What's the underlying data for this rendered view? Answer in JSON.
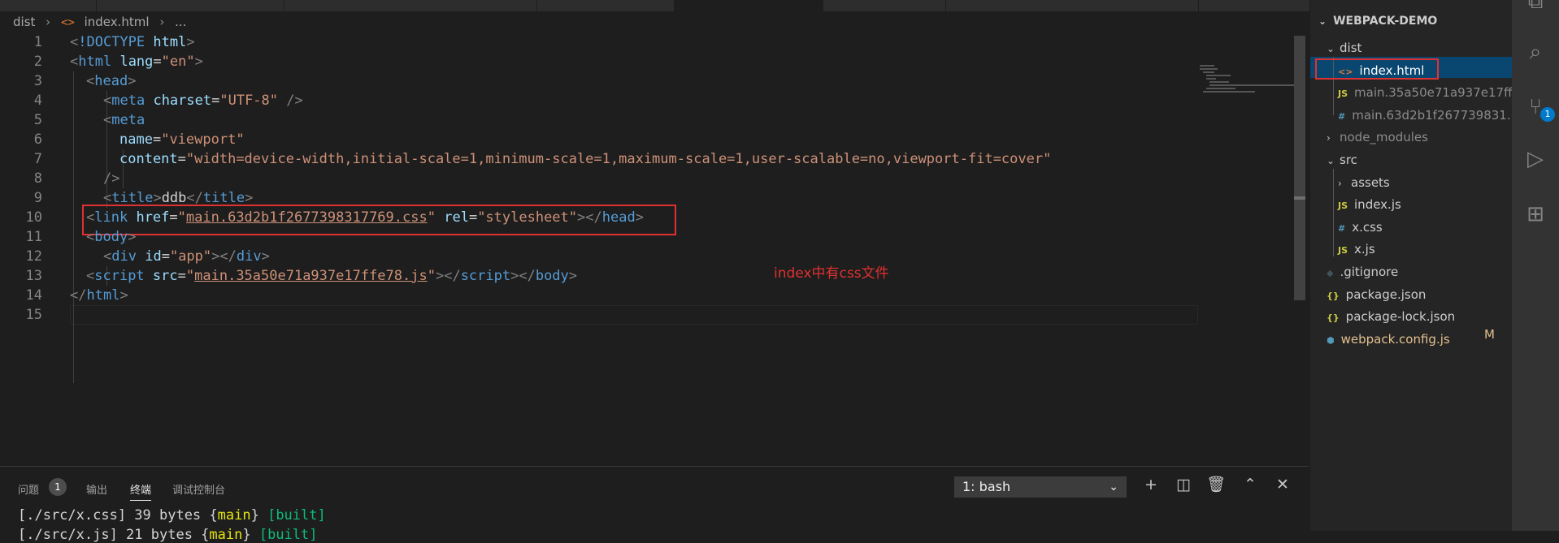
{
  "breadcrumb": {
    "folder": "dist",
    "file": "index.html",
    "more": "..."
  },
  "editor": {
    "lines": [
      {
        "n": "1",
        "indent": 0,
        "tokens": [
          [
            "punc",
            "<"
          ],
          [
            "tag",
            "!DOCTYPE"
          ],
          [
            "text",
            " "
          ],
          [
            "attr",
            "html"
          ],
          [
            "punc",
            ">"
          ]
        ]
      },
      {
        "n": "2",
        "indent": 0,
        "tokens": [
          [
            "punc",
            "<"
          ],
          [
            "tag",
            "html"
          ],
          [
            "text",
            " "
          ],
          [
            "attr",
            "lang"
          ],
          [
            "text",
            "="
          ],
          [
            "str",
            "\"en\""
          ],
          [
            "punc",
            ">"
          ]
        ]
      },
      {
        "n": "3",
        "indent": 1,
        "tokens": [
          [
            "punc",
            "<"
          ],
          [
            "tag",
            "head"
          ],
          [
            "punc",
            ">"
          ]
        ]
      },
      {
        "n": "4",
        "indent": 2,
        "tokens": [
          [
            "punc",
            "<"
          ],
          [
            "tag",
            "meta"
          ],
          [
            "text",
            " "
          ],
          [
            "attr",
            "charset"
          ],
          [
            "text",
            "="
          ],
          [
            "str",
            "\"UTF-8\""
          ],
          [
            "text",
            " "
          ],
          [
            "punc",
            "/>"
          ]
        ]
      },
      {
        "n": "5",
        "indent": 2,
        "tokens": [
          [
            "punc",
            "<"
          ],
          [
            "tag",
            "meta"
          ]
        ]
      },
      {
        "n": "6",
        "indent": 3,
        "tokens": [
          [
            "attr",
            "name"
          ],
          [
            "text",
            "="
          ],
          [
            "str",
            "\"viewport\""
          ]
        ]
      },
      {
        "n": "7",
        "indent": 3,
        "tokens": [
          [
            "attr",
            "content"
          ],
          [
            "text",
            "="
          ],
          [
            "str",
            "\"width=device-width,initial-scale=1,minimum-scale=1,maximum-scale=1,user-scalable=no,viewport-fit=cover\""
          ]
        ]
      },
      {
        "n": "8",
        "indent": 2,
        "tokens": [
          [
            "punc",
            "/>"
          ]
        ]
      },
      {
        "n": "9",
        "indent": 2,
        "tokens": [
          [
            "punc",
            "<"
          ],
          [
            "tag",
            "title"
          ],
          [
            "punc",
            ">"
          ],
          [
            "text",
            "ddb"
          ],
          [
            "punc",
            "</"
          ],
          [
            "tag",
            "title"
          ],
          [
            "punc",
            ">"
          ]
        ]
      },
      {
        "n": "10",
        "indent": 1,
        "tokens": [
          [
            "punc",
            "<"
          ],
          [
            "tag",
            "link"
          ],
          [
            "text",
            " "
          ],
          [
            "attr",
            "href"
          ],
          [
            "text",
            "="
          ],
          [
            "str",
            "\""
          ],
          [
            "strlink",
            "main.63d2b1f2677398317769.css"
          ],
          [
            "str",
            "\""
          ],
          [
            "text",
            " "
          ],
          [
            "attr",
            "rel"
          ],
          [
            "text",
            "="
          ],
          [
            "str",
            "\"stylesheet\""
          ],
          [
            "punc",
            "></"
          ],
          [
            "tag",
            "head"
          ],
          [
            "punc",
            ">"
          ]
        ]
      },
      {
        "n": "11",
        "indent": 1,
        "tokens": [
          [
            "punc",
            "<"
          ],
          [
            "tag",
            "body"
          ],
          [
            "punc",
            ">"
          ]
        ]
      },
      {
        "n": "12",
        "indent": 2,
        "tokens": [
          [
            "punc",
            "<"
          ],
          [
            "tag",
            "div"
          ],
          [
            "text",
            " "
          ],
          [
            "attr",
            "id"
          ],
          [
            "text",
            "="
          ],
          [
            "str",
            "\"app\""
          ],
          [
            "punc",
            "></"
          ],
          [
            "tag",
            "div"
          ],
          [
            "punc",
            ">"
          ]
        ]
      },
      {
        "n": "13",
        "indent": 1,
        "tokens": [
          [
            "punc",
            "<"
          ],
          [
            "tag",
            "script"
          ],
          [
            "text",
            " "
          ],
          [
            "attr",
            "src"
          ],
          [
            "text",
            "="
          ],
          [
            "str",
            "\""
          ],
          [
            "strlink",
            "main.35a50e71a937e17ffe78.js"
          ],
          [
            "str",
            "\""
          ],
          [
            "punc",
            "></"
          ],
          [
            "tag",
            "script"
          ],
          [
            "punc",
            "></"
          ],
          [
            "tag",
            "body"
          ],
          [
            "punc",
            ">"
          ]
        ]
      },
      {
        "n": "14",
        "indent": 0,
        "tokens": [
          [
            "punc",
            "</"
          ],
          [
            "tag",
            "html"
          ],
          [
            "punc",
            ">"
          ]
        ]
      },
      {
        "n": "15",
        "indent": 0,
        "tokens": []
      }
    ],
    "annotation": "index中有css文件"
  },
  "panel": {
    "tabs": [
      "问题",
      "输出",
      "终端",
      "调试控制台"
    ],
    "problems_count": "1",
    "active_tab": "终端",
    "terminal_select": "1: bash",
    "terminal_lines": [
      [
        [
          "text",
          "[./src/x.css] 39 bytes {"
        ],
        [
          "yel",
          "main"
        ],
        [
          "text",
          "} "
        ],
        [
          "grn",
          "[built]"
        ]
      ],
      [
        [
          "text",
          "[./src/x.js] 21 bytes {"
        ],
        [
          "yel",
          "main"
        ],
        [
          "text",
          "} "
        ],
        [
          "grn",
          "[built]"
        ]
      ]
    ]
  },
  "explorer": {
    "title": "WEBPACK-DEMO",
    "items": [
      {
        "label": "dist",
        "kind": "folder-open",
        "depth": 1
      },
      {
        "label": "index.html",
        "kind": "html",
        "icon": "<>",
        "depth": 2,
        "selected": true
      },
      {
        "label": "main.35a50e71a937e17ff...",
        "kind": "js",
        "icon": "JS",
        "depth": 2,
        "dim": true
      },
      {
        "label": "main.63d2b1f267739831...",
        "kind": "css",
        "icon": "#",
        "depth": 2,
        "dim": true
      },
      {
        "label": "node_modules",
        "kind": "folder",
        "depth": 1,
        "dim": true
      },
      {
        "label": "src",
        "kind": "folder-open",
        "depth": 1
      },
      {
        "label": "assets",
        "kind": "folder",
        "depth": 2
      },
      {
        "label": "index.js",
        "kind": "js",
        "icon": "JS",
        "depth": 2
      },
      {
        "label": "x.css",
        "kind": "css",
        "icon": "#",
        "depth": 2
      },
      {
        "label": "x.js",
        "kind": "js",
        "icon": "JS",
        "depth": 2
      },
      {
        "label": ".gitignore",
        "kind": "git",
        "icon": "◆",
        "depth": 1
      },
      {
        "label": "package.json",
        "kind": "json",
        "icon": "{}",
        "depth": 1
      },
      {
        "label": "package-lock.json",
        "kind": "json",
        "icon": "{}",
        "depth": 1
      },
      {
        "label": "webpack.config.js",
        "kind": "wp",
        "icon": "⬢",
        "depth": 1,
        "modified": true
      }
    ],
    "modified_badge": "M"
  },
  "activity": {
    "scm_badge": "1",
    "icons": [
      "explorer-icon",
      "search-icon",
      "source-control-icon",
      "debug-icon",
      "extensions-icon"
    ]
  }
}
